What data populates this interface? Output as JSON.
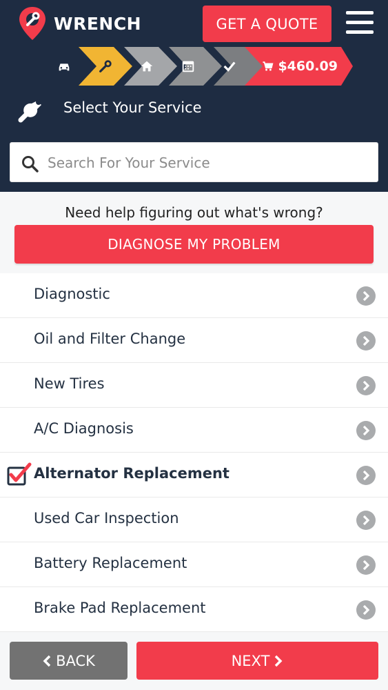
{
  "header": {
    "brand": "WRENCH",
    "quote_button": "GET A QUOTE"
  },
  "stepper": {
    "cart_total": "$460.09",
    "steps": [
      "car-icon",
      "wrench-icon",
      "home-icon",
      "calendar-icon",
      "check-icon",
      "cart-icon"
    ],
    "active_step": 1
  },
  "section": {
    "title": "Select Your Service"
  },
  "search": {
    "placeholder": "Search For Your Service",
    "value": ""
  },
  "help": {
    "text": "Need help figuring out what's wrong?",
    "button": "DIAGNOSE MY PROBLEM"
  },
  "services": [
    {
      "label": "Diagnostic",
      "selected": false
    },
    {
      "label": "Oil and Filter Change",
      "selected": false
    },
    {
      "label": "New Tires",
      "selected": false
    },
    {
      "label": "A/C Diagnosis",
      "selected": false
    },
    {
      "label": "Alternator Replacement",
      "selected": true
    },
    {
      "label": "Used Car Inspection",
      "selected": false
    },
    {
      "label": "Battery Replacement",
      "selected": false
    },
    {
      "label": "Brake Pad Replacement",
      "selected": false
    }
  ],
  "footer": {
    "back": "BACK",
    "next": "NEXT"
  },
  "colors": {
    "navy": "#1e2c42",
    "accent_red": "#f23c4b",
    "active_step_yellow": "#f1b533",
    "grey_button": "#727272"
  }
}
